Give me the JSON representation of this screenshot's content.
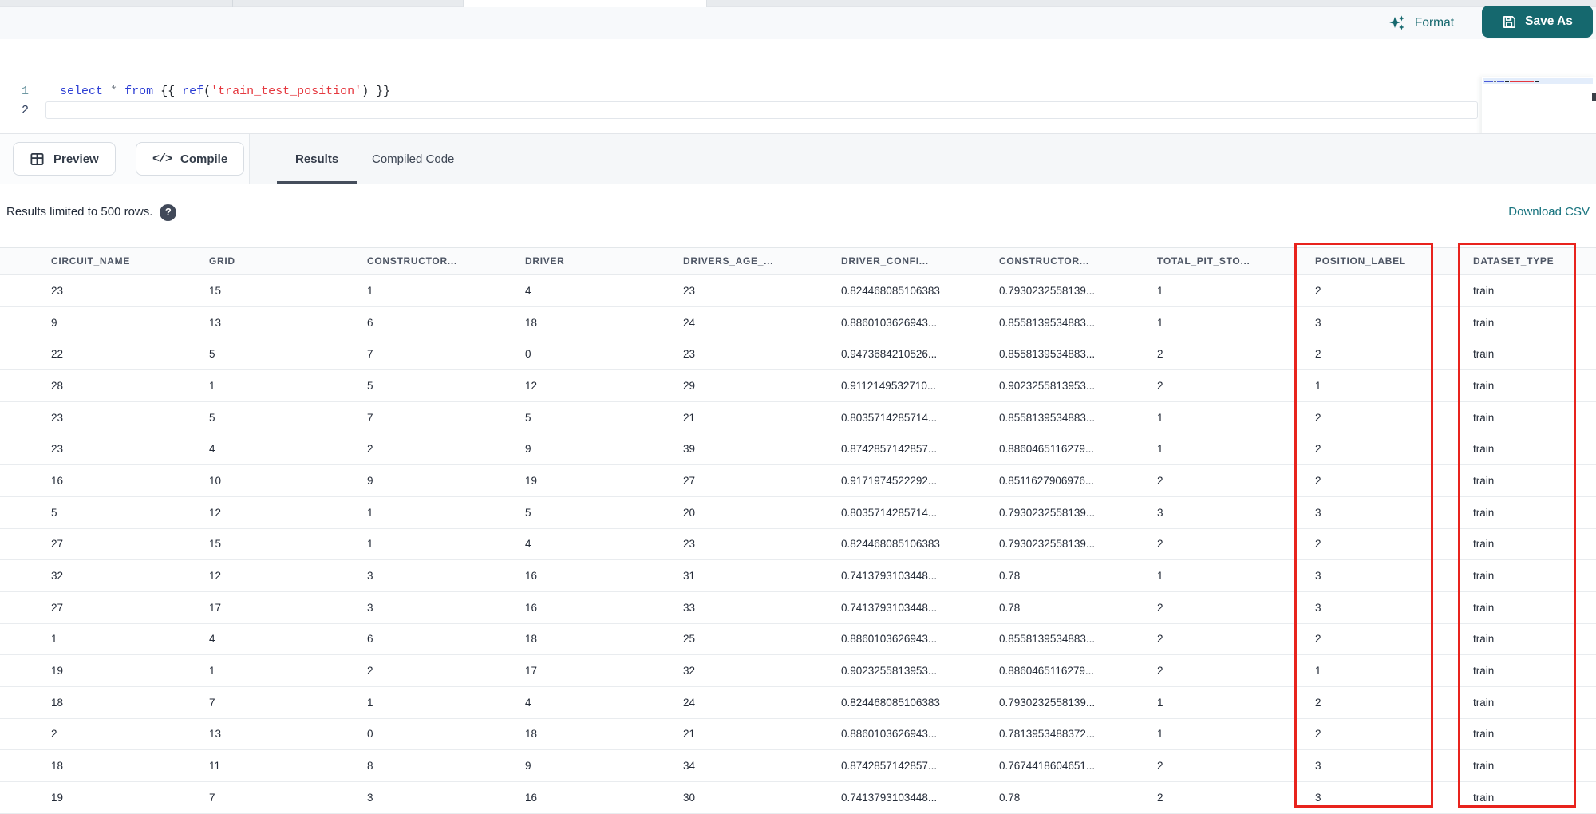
{
  "colors": {
    "accent-teal": "#15686e",
    "highlight-red": "#e8231d",
    "code-keyword": "#2d3fd4",
    "code-string": "#e5383f",
    "code-punct": "#21262d",
    "code-operator": "#7a828c"
  },
  "toolbar": {
    "format_label": "Format",
    "save_as_label": "Save As"
  },
  "editor": {
    "line_numbers": [
      "1",
      "2"
    ],
    "code_text": "select * from {{ ref('train_test_position') }}",
    "tokens": [
      {
        "text": "select",
        "type": "keyword"
      },
      {
        "text": " ",
        "type": "punct"
      },
      {
        "text": "*",
        "type": "operator"
      },
      {
        "text": " ",
        "type": "punct"
      },
      {
        "text": "from",
        "type": "keyword"
      },
      {
        "text": " {{ ",
        "type": "punct"
      },
      {
        "text": "ref",
        "type": "keyword"
      },
      {
        "text": "(",
        "type": "punct"
      },
      {
        "text": "'train_test_position'",
        "type": "string"
      },
      {
        "text": ") }}",
        "type": "punct"
      }
    ]
  },
  "actions": {
    "preview_label": "Preview",
    "compile_label": "Compile",
    "compile_icon": "</>"
  },
  "tabs": [
    {
      "label": "Results",
      "active": true
    },
    {
      "label": "Compiled Code",
      "active": false
    }
  ],
  "results_bar": {
    "limit_note": "Results limited to 500 rows.",
    "help_icon": "?",
    "download_label": "Download CSV"
  },
  "table": {
    "columns": [
      "CIRCUIT_NAME",
      "GRID",
      "CONSTRUCTOR...",
      "DRIVER",
      "DRIVERS_AGE_...",
      "DRIVER_CONFI...",
      "CONSTRUCTOR...",
      "TOTAL_PIT_STO...",
      "POSITION_LABEL",
      "DATASET_TYPE"
    ],
    "highlighted_columns": [
      "POSITION_LABEL",
      "DATASET_TYPE"
    ],
    "rows": [
      [
        "23",
        "15",
        "1",
        "4",
        "23",
        "0.824468085106383",
        "0.7930232558139...",
        "1",
        "2",
        "train"
      ],
      [
        "9",
        "13",
        "6",
        "18",
        "24",
        "0.8860103626943...",
        "0.8558139534883...",
        "1",
        "3",
        "train"
      ],
      [
        "22",
        "5",
        "7",
        "0",
        "23",
        "0.9473684210526...",
        "0.8558139534883...",
        "2",
        "2",
        "train"
      ],
      [
        "28",
        "1",
        "5",
        "12",
        "29",
        "0.9112149532710...",
        "0.9023255813953...",
        "2",
        "1",
        "train"
      ],
      [
        "23",
        "5",
        "7",
        "5",
        "21",
        "0.8035714285714...",
        "0.8558139534883...",
        "1",
        "2",
        "train"
      ],
      [
        "23",
        "4",
        "2",
        "9",
        "39",
        "0.8742857142857...",
        "0.8860465116279...",
        "1",
        "2",
        "train"
      ],
      [
        "16",
        "10",
        "9",
        "19",
        "27",
        "0.9171974522292...",
        "0.8511627906976...",
        "2",
        "2",
        "train"
      ],
      [
        "5",
        "12",
        "1",
        "5",
        "20",
        "0.8035714285714...",
        "0.7930232558139...",
        "3",
        "3",
        "train"
      ],
      [
        "27",
        "15",
        "1",
        "4",
        "23",
        "0.824468085106383",
        "0.7930232558139...",
        "2",
        "2",
        "train"
      ],
      [
        "32",
        "12",
        "3",
        "16",
        "31",
        "0.7413793103448...",
        "0.78",
        "1",
        "3",
        "train"
      ],
      [
        "27",
        "17",
        "3",
        "16",
        "33",
        "0.7413793103448...",
        "0.78",
        "2",
        "3",
        "train"
      ],
      [
        "1",
        "4",
        "6",
        "18",
        "25",
        "0.8860103626943...",
        "0.8558139534883...",
        "2",
        "2",
        "train"
      ],
      [
        "19",
        "1",
        "2",
        "17",
        "32",
        "0.9023255813953...",
        "0.8860465116279...",
        "2",
        "1",
        "train"
      ],
      [
        "18",
        "7",
        "1",
        "4",
        "24",
        "0.824468085106383",
        "0.7930232558139...",
        "1",
        "2",
        "train"
      ],
      [
        "2",
        "13",
        "0",
        "18",
        "21",
        "0.8860103626943...",
        "0.7813953488372...",
        "1",
        "2",
        "train"
      ],
      [
        "18",
        "11",
        "8",
        "9",
        "34",
        "0.8742857142857...",
        "0.7674418604651...",
        "2",
        "3",
        "train"
      ],
      [
        "19",
        "7",
        "3",
        "16",
        "30",
        "0.7413793103448...",
        "0.78",
        "2",
        "3",
        "train"
      ]
    ]
  }
}
